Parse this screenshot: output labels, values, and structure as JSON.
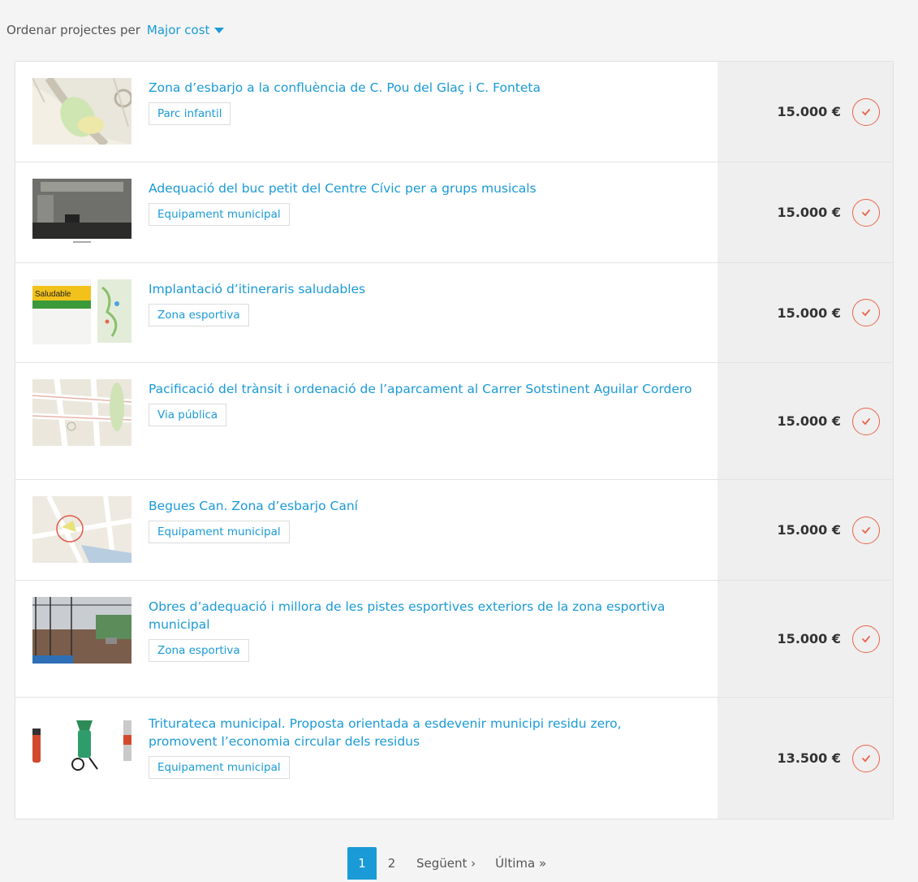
{
  "sort": {
    "label": "Ordenar projectes per",
    "value": "Major cost"
  },
  "projects": [
    {
      "title": "Zona d’esbarjo a la confluència de C. Pou del Glaç i C. Fonteta",
      "tag": "Parc infantil",
      "cost": "15.000 €",
      "thumb": "map-playground-thumbnail"
    },
    {
      "title": "Adequació del buc petit del Centre Cívic per a grups musicals",
      "tag": "Equipament municipal",
      "cost": "15.000 €",
      "thumb": "empty-room-photo-thumbnail"
    },
    {
      "title": "Implantació d’itineraris saludables",
      "tag": "Zona esportiva",
      "cost": "15.000 €",
      "thumb": "healthy-route-sign-thumbnail",
      "thumb_text": "Saludable"
    },
    {
      "title": "Pacificació del trànsit i ordenació de l’aparcament al Carrer Sotstinent Aguilar Cordero",
      "tag": "Via pública",
      "cost": "15.000 €",
      "thumb": "street-map-thumbnail"
    },
    {
      "title": "Begues Can. Zona d’esbarjo Caní",
      "tag": "Equipament municipal",
      "cost": "15.000 €",
      "thumb": "dog-area-map-thumbnail"
    },
    {
      "title": "Obres d’adequació i millora de les pistes esportives exteriors de la zona esportiva municipal",
      "tag": "Zona esportiva",
      "cost": "15.000 €",
      "thumb": "sports-court-photo-thumbnail"
    },
    {
      "title": "Triturateca municipal. Proposta orientada a esdevenir municipi residu zero, promovent l’economia circular dels residus",
      "tag": "Equipament municipal",
      "cost": "13.500 €",
      "thumb": "garden-shredders-thumbnail"
    }
  ],
  "pagination": {
    "pages": [
      "1",
      "2"
    ],
    "next": "Següent ›",
    "last": "Última »"
  },
  "colors": {
    "accent": "#1a9ad6",
    "check": "#e8654a"
  }
}
